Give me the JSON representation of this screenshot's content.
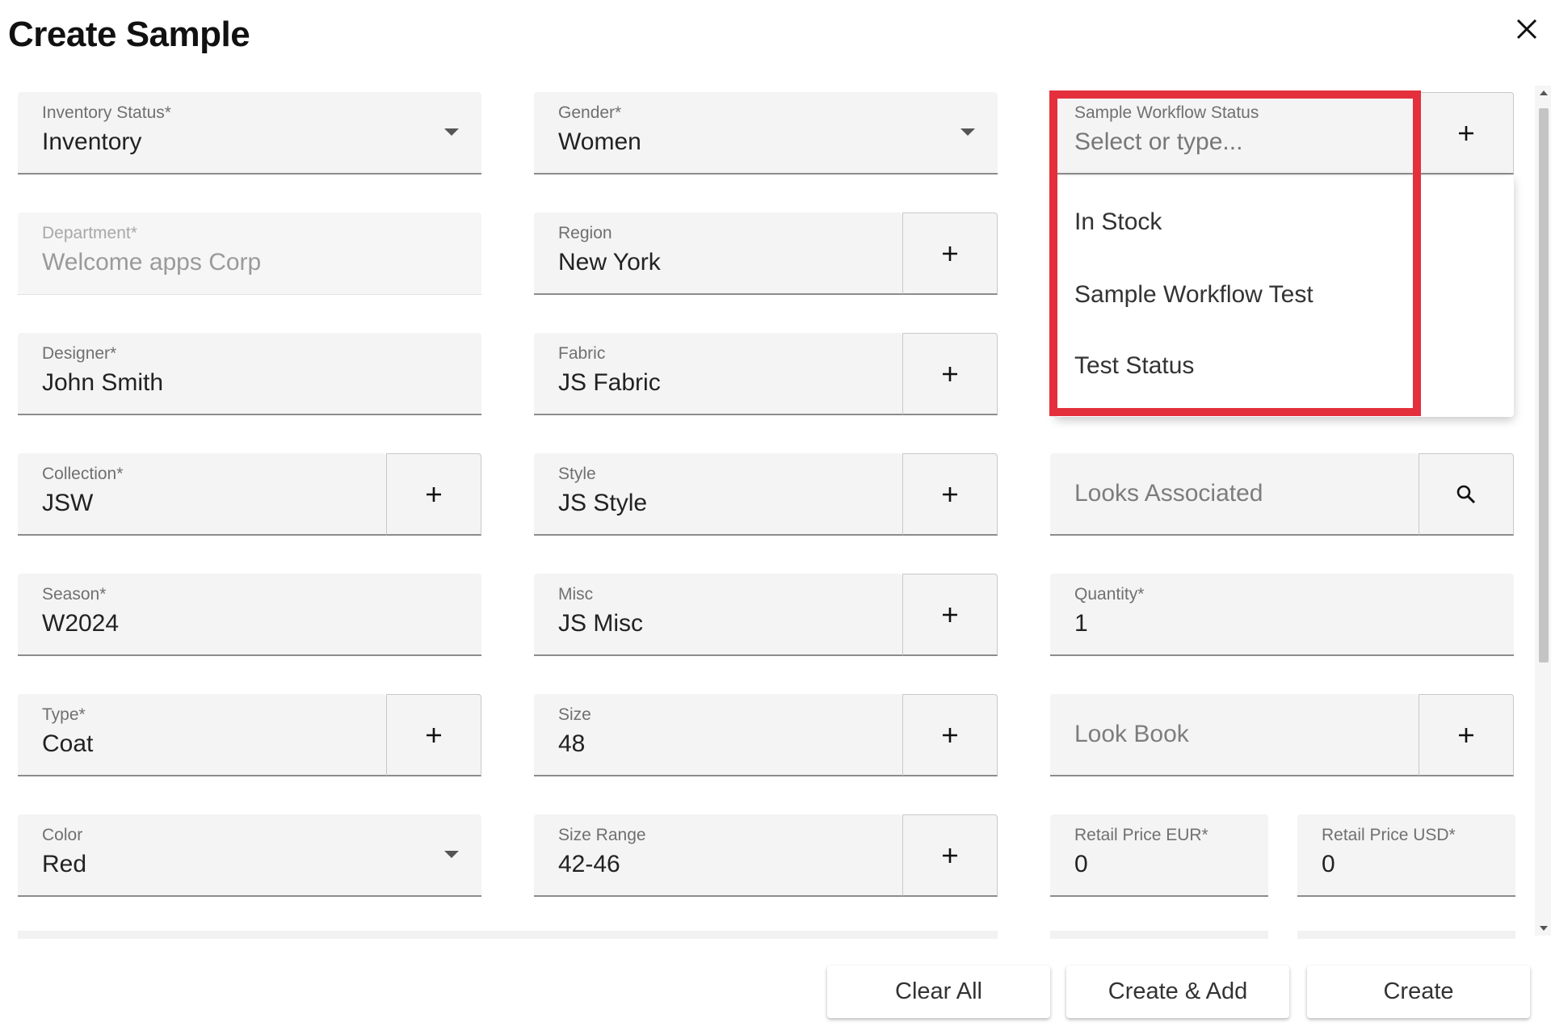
{
  "dialog": {
    "title": "Create Sample"
  },
  "icons": {
    "close": "close-icon",
    "dropdown": "chevron-down-icon",
    "add": "plus-icon",
    "search": "search-icon"
  },
  "fields": {
    "inventory_status": {
      "label": "Inventory Status*",
      "value": "Inventory"
    },
    "department": {
      "label": "Department*",
      "value": "Welcome apps Corp"
    },
    "designer": {
      "label": "Designer*",
      "value": "John Smith"
    },
    "collection": {
      "label": "Collection*",
      "value": "JSW"
    },
    "season": {
      "label": "Season*",
      "value": "W2024"
    },
    "type": {
      "label": "Type*",
      "value": "Coat"
    },
    "color": {
      "label": "Color",
      "value": "Red"
    },
    "gender": {
      "label": "Gender*",
      "value": "Women"
    },
    "region": {
      "label": "Region",
      "value": "New York"
    },
    "fabric": {
      "label": "Fabric",
      "value": "JS Fabric"
    },
    "style": {
      "label": "Style",
      "value": "JS Style"
    },
    "misc": {
      "label": "Misc",
      "value": "JS Misc"
    },
    "size": {
      "label": "Size",
      "value": "48"
    },
    "size_range": {
      "label": "Size Range",
      "value": "42-46"
    },
    "sample_workflow_status": {
      "label": "Sample Workflow Status",
      "placeholder": "Select or type..."
    },
    "looks_associated": {
      "placeholder": "Looks Associated"
    },
    "quantity": {
      "label": "Quantity*",
      "value": "1"
    },
    "look_book": {
      "placeholder": "Look Book"
    },
    "retail_price_eur": {
      "label": "Retail Price EUR*",
      "value": "0"
    },
    "retail_price_usd": {
      "label": "Retail Price USD*",
      "value": "0"
    }
  },
  "workflow_menu": {
    "options": [
      "In Stock",
      "Sample Workflow Test",
      "Test Status"
    ]
  },
  "actions": {
    "clear_all": "Clear All",
    "create_add": "Create & Add",
    "create": "Create"
  },
  "colors": {
    "highlight": "#e4303c",
    "field_bg": "#f4f4f4",
    "underline": "#8c8c8c"
  }
}
